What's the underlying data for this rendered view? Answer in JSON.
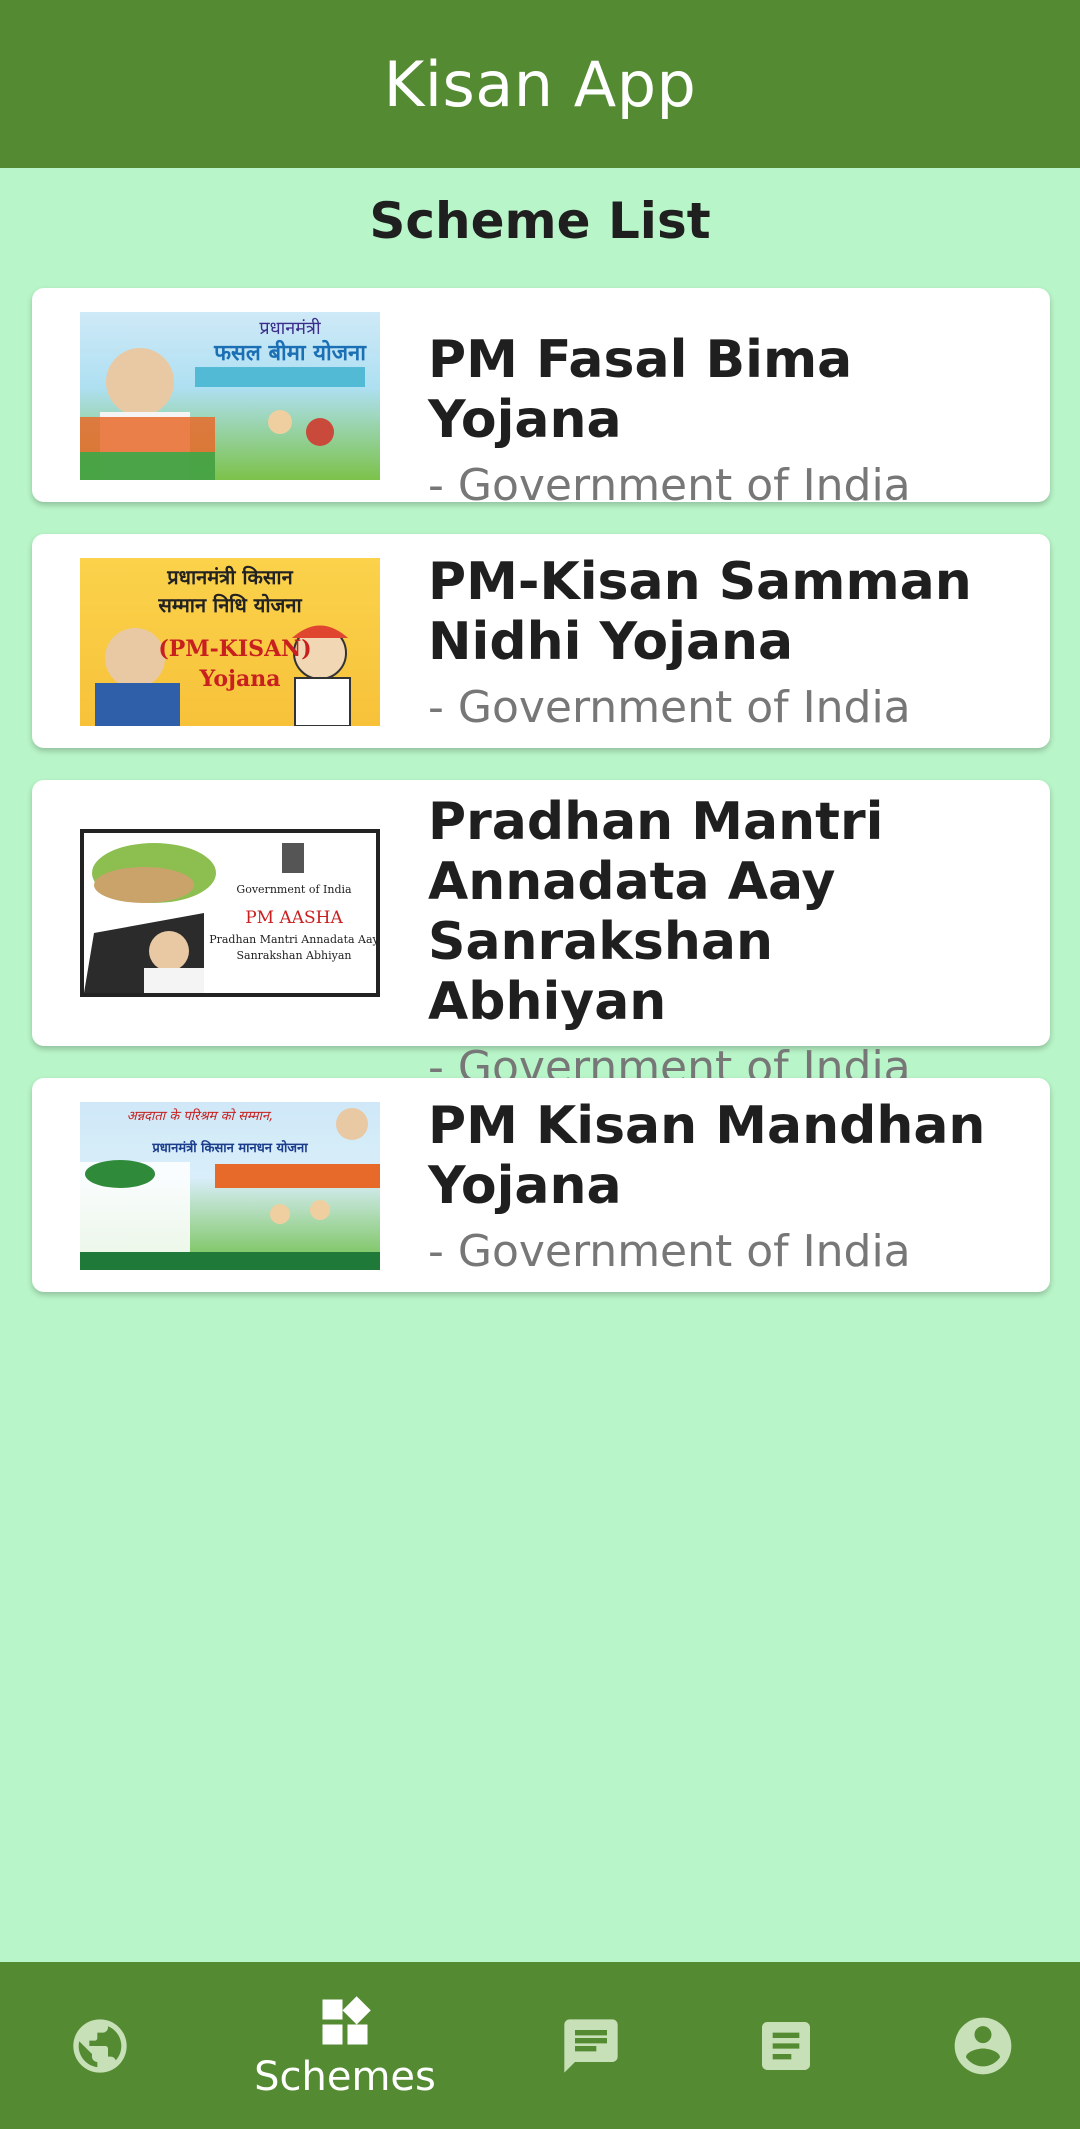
{
  "app_bar": {
    "title": "Kisan App"
  },
  "section_title": "Scheme List",
  "schemes": [
    {
      "title": "PM Fasal Bima Yojana",
      "subtitle": "- Government of India",
      "thumb_text": [
        "प्रधानमंत्री",
        "फसल बीमा योजना"
      ]
    },
    {
      "title": "PM-Kisan Samman Nidhi Yojana",
      "subtitle": "- Government of India",
      "thumb_text": [
        "प्रधानमंत्री किसान",
        "सम्मान निधि योजना",
        "(PM-KISAN)",
        "Yojana"
      ]
    },
    {
      "title": "Pradhan Mantri Annadata Aay Sanrakshan Abhiyan",
      "subtitle": "- Government of India",
      "thumb_text": [
        "Government of India",
        "PM AASHA",
        "Pradhan Mantri Annadata Aay",
        "Sanrakshan Abhiyan"
      ]
    },
    {
      "title": "PM Kisan Mandhan Yojana",
      "subtitle": "- Government of India",
      "thumb_text": [
        "अन्नदाता के परिश्रम को सम्मान,",
        "प्रधानमंत्री किसान मानधन योजना"
      ]
    }
  ],
  "bottom_nav": {
    "items": [
      {
        "icon": "globe-icon",
        "label": ""
      },
      {
        "icon": "schemes-icon",
        "label": "Schemes",
        "active": true
      },
      {
        "icon": "chat-icon",
        "label": ""
      },
      {
        "icon": "article-icon",
        "label": ""
      },
      {
        "icon": "account-icon",
        "label": ""
      }
    ]
  },
  "colors": {
    "primary": "#548b32",
    "background": "#b8f5c8",
    "card": "#ffffff",
    "nav_inactive": "#c7e0b8"
  }
}
